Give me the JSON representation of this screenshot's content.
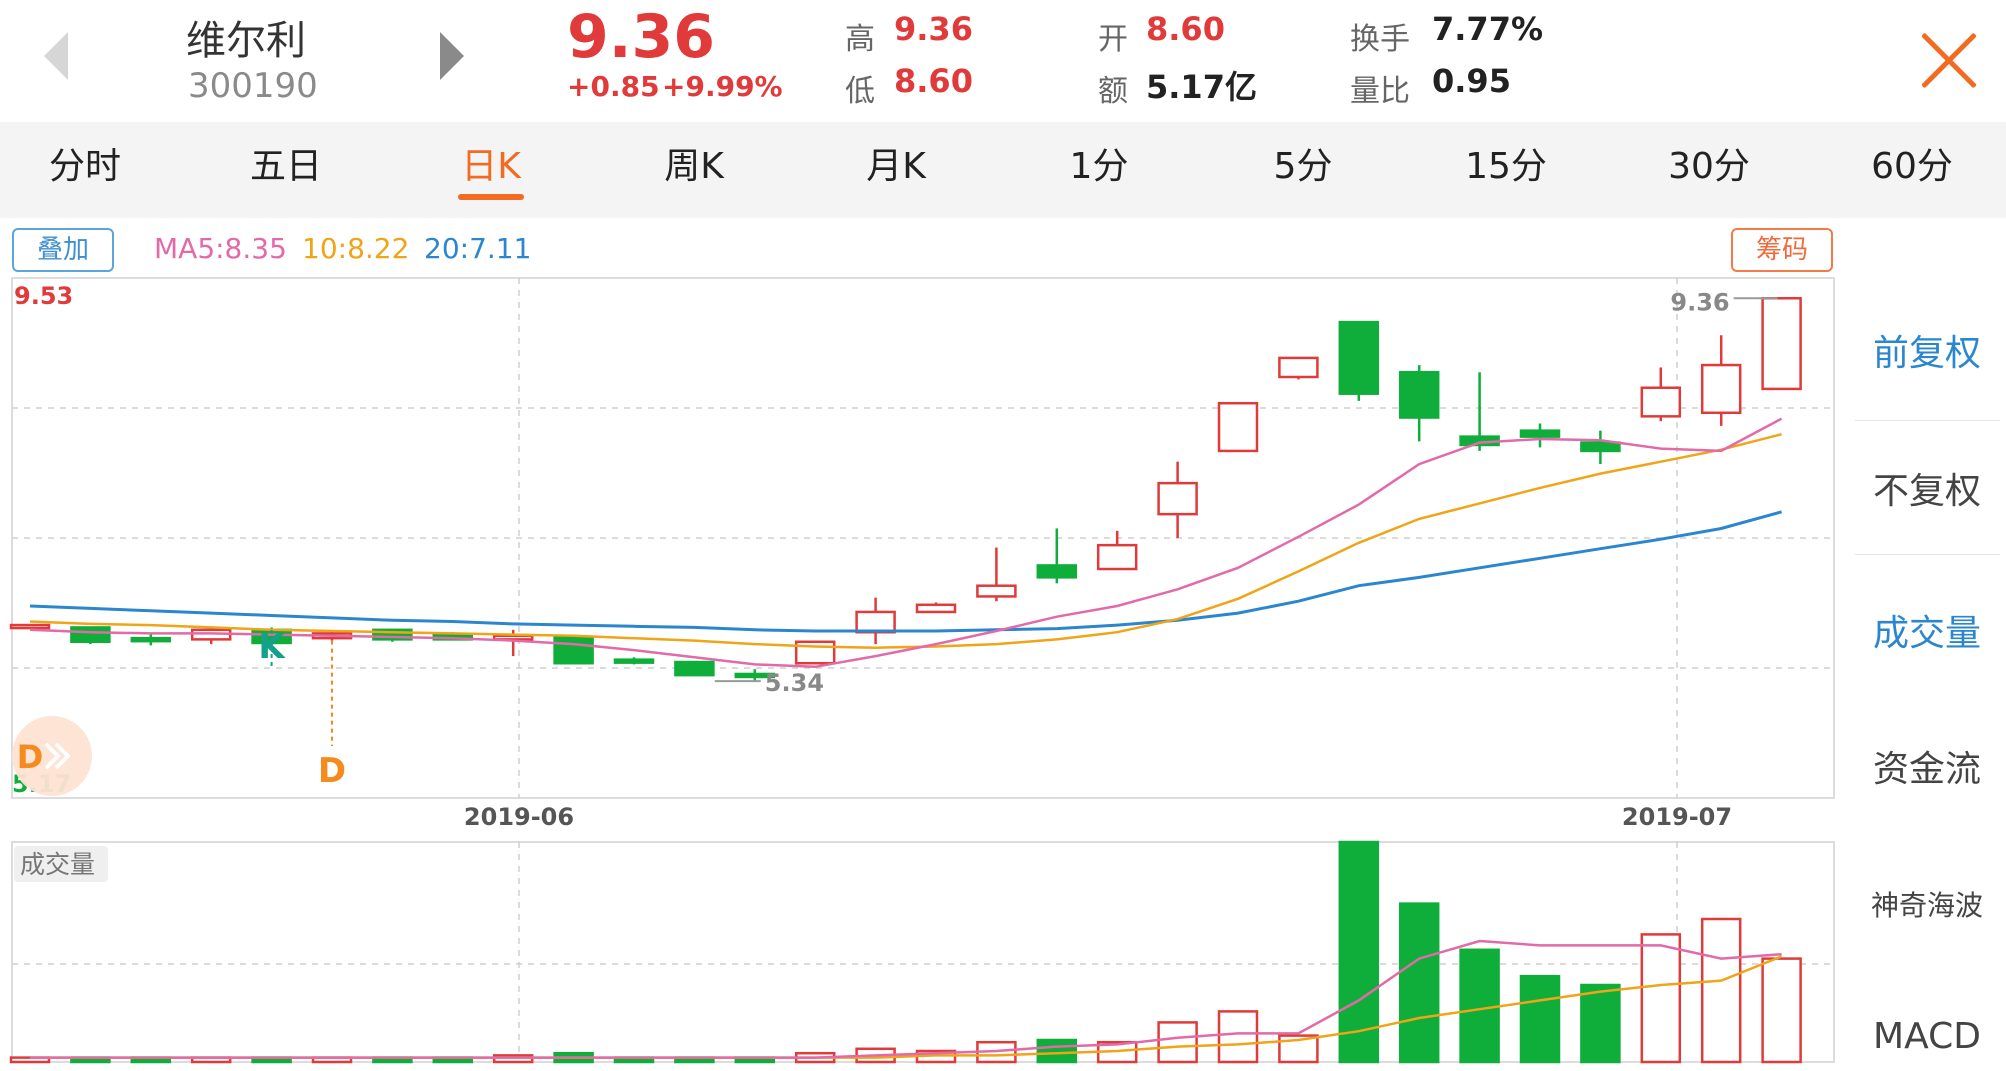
{
  "header": {
    "stock_name": "维尔利",
    "stock_code": "300190",
    "price": "9.36",
    "change": "+0.85",
    "change_pct": "+9.99%",
    "stats": [
      {
        "label": "高",
        "value": "9.36",
        "color": "red"
      },
      {
        "label": "低",
        "value": "8.60",
        "color": "red"
      },
      {
        "label": "开",
        "value": "8.60",
        "color": "red"
      },
      {
        "label": "额",
        "value": "5.17亿",
        "color": "dark"
      },
      {
        "label": "换手",
        "value": "7.77%",
        "color": "dark"
      },
      {
        "label": "量比",
        "value": "0.95",
        "color": "dark"
      }
    ]
  },
  "tabs": [
    "分时",
    "五日",
    "日K",
    "周K",
    "月K",
    "1分",
    "5分",
    "15分",
    "30分",
    "60分"
  ],
  "active_tab": "日K",
  "overlay_button": "叠加",
  "chips_button": "筹码",
  "ma_legend": {
    "ma5": "MA5:8.35",
    "ma10": "10:8.22",
    "ma20": "20:7.11"
  },
  "side_menu": [
    "前复权",
    "不复权",
    "成交量",
    "资金流",
    "神奇海波",
    "MACD"
  ],
  "colors": {
    "up": "#e03a3a",
    "down": "#0fae3a",
    "ma5": "#e26aa8",
    "ma10": "#f0a417",
    "ma20": "#2b86cf",
    "accent": "#f26b22",
    "link": "#2b86cf"
  },
  "chart_data": {
    "type": "candlestick",
    "y_axis_top": "9.53",
    "y_axis_bottom": "5.17",
    "ylim": [
      5.17,
      9.53
    ],
    "x_labels": [
      "2019-06",
      "2019-07"
    ],
    "annotations": {
      "high_label": "9.36",
      "low_label": "5.34",
      "signal_k": "K",
      "signal_d": "D"
    },
    "volume_panel_label": "成交量",
    "candles": [
      {
        "open": 6.62,
        "close": 6.62,
        "high": 6.62,
        "low": 6.62
      },
      {
        "open": 6.6,
        "close": 6.48,
        "high": 6.6,
        "low": 6.46
      },
      {
        "open": 6.51,
        "close": 6.49,
        "high": 6.55,
        "low": 6.45
      },
      {
        "open": 6.5,
        "close": 6.58,
        "high": 6.6,
        "low": 6.46
      },
      {
        "open": 6.58,
        "close": 6.47,
        "high": 6.6,
        "low": 6.47
      },
      {
        "open": 6.51,
        "close": 6.55,
        "high": 6.57,
        "low": 6.49
      },
      {
        "open": 6.58,
        "close": 6.5,
        "high": 6.58,
        "low": 6.48
      },
      {
        "open": 6.54,
        "close": 6.5,
        "high": 6.56,
        "low": 6.5
      },
      {
        "open": 6.5,
        "close": 6.53,
        "high": 6.58,
        "low": 6.36
      },
      {
        "open": 6.52,
        "close": 6.3,
        "high": 6.52,
        "low": 6.29
      },
      {
        "open": 6.33,
        "close": 6.31,
        "high": 6.35,
        "low": 6.29
      },
      {
        "open": 6.31,
        "close": 6.2,
        "high": 6.31,
        "low": 6.2
      },
      {
        "open": 6.21,
        "close": 6.19,
        "high": 6.25,
        "low": 6.15
      },
      {
        "open": 6.3,
        "close": 6.48,
        "high": 6.48,
        "low": 6.3
      },
      {
        "open": 6.56,
        "close": 6.73,
        "high": 6.85,
        "low": 6.46
      },
      {
        "open": 6.73,
        "close": 6.79,
        "high": 6.81,
        "low": 6.73
      },
      {
        "open": 6.86,
        "close": 6.95,
        "high": 7.27,
        "low": 6.82
      },
      {
        "open": 7.12,
        "close": 7.02,
        "high": 7.43,
        "low": 6.97
      },
      {
        "open": 7.09,
        "close": 7.29,
        "high": 7.41,
        "low": 7.09
      },
      {
        "open": 7.55,
        "close": 7.81,
        "high": 7.99,
        "low": 7.35
      },
      {
        "open": 8.08,
        "close": 8.48,
        "high": 8.48,
        "low": 8.08
      },
      {
        "open": 8.7,
        "close": 8.86,
        "high": 8.86,
        "low": 8.68
      },
      {
        "open": 9.16,
        "close": 8.56,
        "high": 9.16,
        "low": 8.5
      },
      {
        "open": 8.74,
        "close": 8.36,
        "high": 8.8,
        "low": 8.16
      },
      {
        "open": 8.2,
        "close": 8.13,
        "high": 8.74,
        "low": 8.08
      },
      {
        "open": 8.25,
        "close": 8.2,
        "high": 8.31,
        "low": 8.11
      },
      {
        "open": 8.15,
        "close": 8.08,
        "high": 8.25,
        "low": 7.97
      },
      {
        "open": 8.37,
        "close": 8.61,
        "high": 8.78,
        "low": 8.33
      },
      {
        "open": 8.4,
        "close": 8.8,
        "high": 9.05,
        "low": 8.29
      },
      {
        "open": 8.6,
        "close": 9.36,
        "high": 9.36,
        "low": 8.6
      }
    ],
    "ma5": [
      6.58,
      6.56,
      6.55,
      6.55,
      6.54,
      6.53,
      6.52,
      6.51,
      6.49,
      6.46,
      6.41,
      6.35,
      6.29,
      6.27,
      6.36,
      6.46,
      6.57,
      6.69,
      6.78,
      6.92,
      7.1,
      7.36,
      7.63,
      7.97,
      8.15,
      8.18,
      8.17,
      8.1,
      8.08,
      8.35
    ],
    "ma10": [
      6.65,
      6.63,
      6.62,
      6.6,
      6.58,
      6.57,
      6.56,
      6.55,
      6.54,
      6.53,
      6.51,
      6.49,
      6.46,
      6.44,
      6.43,
      6.44,
      6.46,
      6.5,
      6.56,
      6.67,
      6.84,
      7.07,
      7.31,
      7.51,
      7.64,
      7.77,
      7.89,
      7.99,
      8.09,
      8.22
    ],
    "ma20": [
      6.78,
      6.76,
      6.74,
      6.72,
      6.7,
      6.68,
      6.66,
      6.65,
      6.63,
      6.62,
      6.61,
      6.6,
      6.58,
      6.57,
      6.57,
      6.57,
      6.58,
      6.59,
      6.62,
      6.66,
      6.72,
      6.82,
      6.95,
      7.02,
      7.1,
      7.18,
      7.26,
      7.34,
      7.43,
      7.57
    ],
    "volume_scale_max": 100,
    "volume": [
      2,
      2,
      2,
      2,
      2,
      2,
      2,
      2,
      3,
      4,
      2,
      2,
      2,
      4,
      6,
      5,
      9,
      10,
      9,
      18,
      23,
      12,
      100,
      72,
      51,
      39,
      35,
      58,
      65,
      47
    ],
    "vol_ma5": [
      2,
      2,
      2,
      2,
      2,
      2,
      2,
      2,
      2,
      2,
      2,
      2,
      2,
      2,
      3,
      4,
      5,
      7,
      8,
      11,
      13,
      13,
      28,
      47,
      55,
      53,
      53,
      53,
      47,
      49
    ],
    "vol_ma10": [
      2,
      2,
      2,
      2,
      2,
      2,
      2,
      2,
      2,
      2,
      2,
      2,
      2,
      2,
      2,
      3,
      3,
      4,
      5,
      7,
      8,
      10,
      14,
      20,
      24,
      28,
      32,
      35,
      37,
      48
    ]
  }
}
